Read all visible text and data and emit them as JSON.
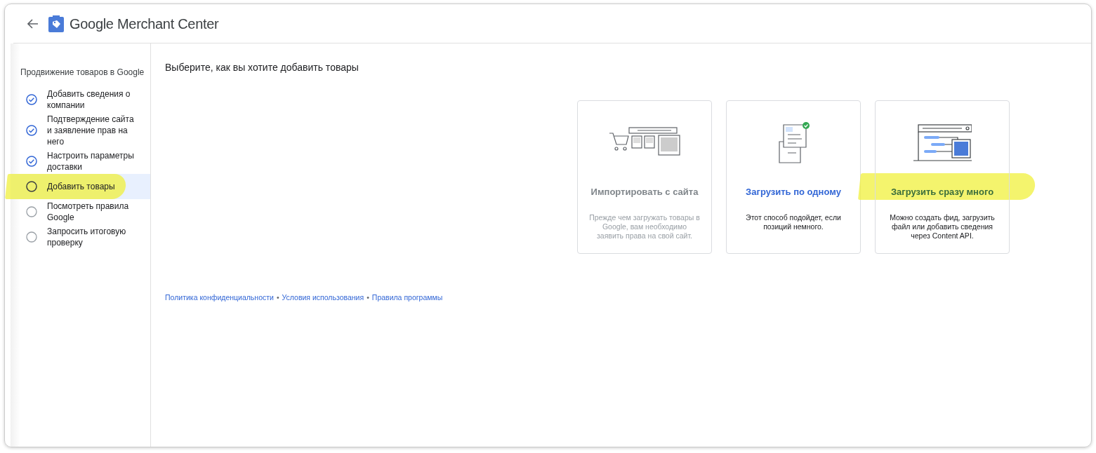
{
  "header": {
    "title": "Google Merchant Center"
  },
  "sidebar": {
    "heading": "Продвижение товаров в Google",
    "steps": [
      {
        "label": "Добавить сведения о компании",
        "completed": true,
        "selected": false,
        "highlighted": false
      },
      {
        "label": "Подтверждение сайта и заявление прав на него",
        "completed": true,
        "selected": false,
        "highlighted": false
      },
      {
        "label": "Настроить параметры доставки",
        "completed": true,
        "selected": false,
        "highlighted": false
      },
      {
        "label": "Добавить товары",
        "completed": false,
        "selected": true,
        "highlighted": true
      },
      {
        "label": "Посмотреть правила Google",
        "completed": false,
        "selected": false,
        "highlighted": false
      },
      {
        "label": "Запросить итоговую проверку",
        "completed": false,
        "selected": false,
        "highlighted": false
      }
    ]
  },
  "main": {
    "title": "Выберите, как вы хотите добавить товары",
    "options": [
      {
        "kind": "import",
        "title": "Импортировать с сайта",
        "description": "Прежде чем загружать товары в Google, вам необходимо заявить права на свой сайт.",
        "disabled": true,
        "highlighted": false
      },
      {
        "kind": "single",
        "title": "Загрузить по одному",
        "description": "Этот способ подойдет, если позиций немного.",
        "disabled": false,
        "highlighted": false
      },
      {
        "kind": "bulk",
        "title": "Загрузить сразу много",
        "description": "Можно создать фид, загрузить файл или добавить сведения через Content API.",
        "disabled": false,
        "highlighted": true
      }
    ]
  },
  "footer": [
    {
      "kind": "link",
      "text": "Политика конфиденциальности"
    },
    {
      "kind": "separator",
      "text": "•"
    },
    {
      "kind": "link",
      "text": "Условия использования"
    },
    {
      "kind": "separator",
      "text": "•"
    },
    {
      "kind": "link",
      "text": "Правила программы"
    }
  ]
}
